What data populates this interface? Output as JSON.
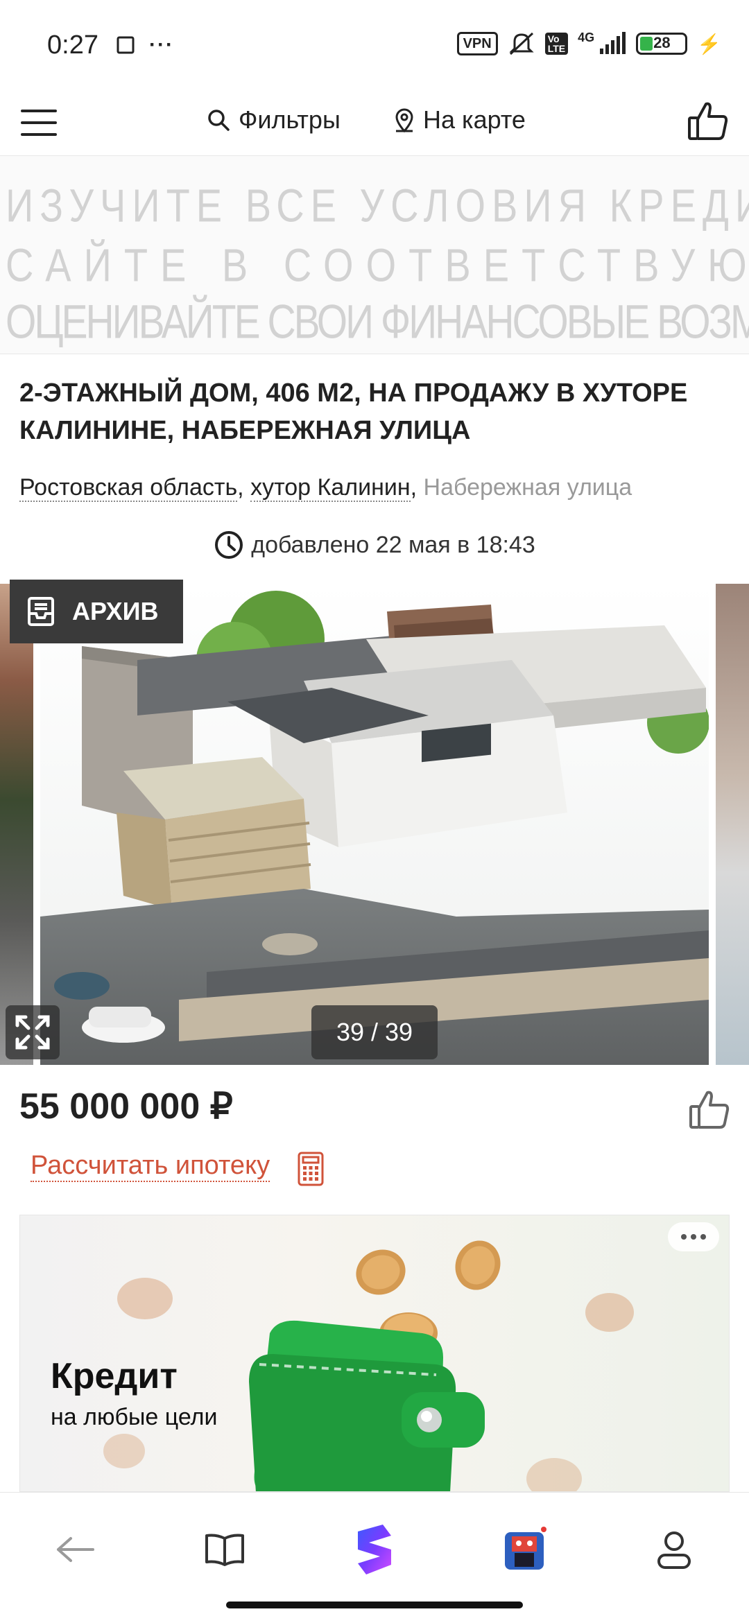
{
  "status_bar": {
    "time": "0:27",
    "vpn": "VPN",
    "network": "4G",
    "battery": "28"
  },
  "nav": {
    "filters_label": "Фильтры",
    "map_label": "На карте"
  },
  "disclaimer": {
    "line1": "ИЗУЧИТЕ ВСЕ УСЛОВИЯ КРЕДИТА (ЗАЙМА) НА",
    "line2": "САЙТЕ В СООТВЕТСТВУЮЩЕМ РАЗДЕЛЕ.",
    "line3": "ОЦЕНИВАЙТЕ СВОИ ФИНАНСОВЫЕ ВОЗМОЖНОСТИ И РИСКИ"
  },
  "listing": {
    "title": "2-этажный дом, 406 м2, на продажу в хуторе Калинине, Набережная улица",
    "address": {
      "region": "Ростовская область",
      "locality": "хутор Калинин",
      "street": "Набережная улица"
    },
    "added": "добавлено 22 мая в 18:43",
    "archive_label": "АРХИВ",
    "photo_counter": "39 / 39",
    "price": "55 000 000 ₽",
    "mortgage_link": "Рассчитать ипотеку"
  },
  "ad": {
    "headline": "Кредит",
    "subline": "на любые цели"
  },
  "icons": {
    "menu": "hamburger-icon",
    "search": "search-icon",
    "map": "map-pin-icon",
    "like": "thumbs-up-icon",
    "clock": "clock-icon",
    "archive": "archive-icon",
    "expand": "expand-icon",
    "calculator": "calculator-icon",
    "back": "back-arrow-icon",
    "book": "book-icon",
    "app": "app-logo-icon",
    "game": "game-avatar-icon",
    "profile": "profile-icon"
  },
  "colors": {
    "accent_red": "#d0533a",
    "archive_bg": "#3a3a3a"
  }
}
